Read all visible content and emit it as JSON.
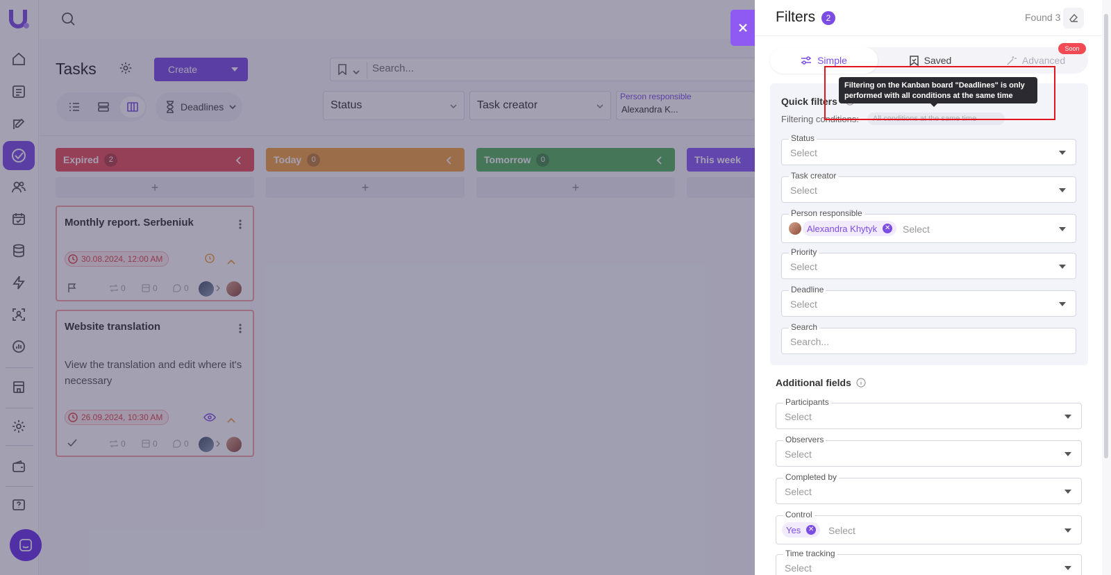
{
  "app": {
    "title": "Tasks"
  },
  "toolbar": {
    "create_label": "Create",
    "search_placeholder": "Search...",
    "view_selector": "Deadlines"
  },
  "filter_bar": {
    "status": "Status",
    "task_creator": "Task creator",
    "person_label": "Person responsible",
    "person_value": "Alexandra K..."
  },
  "columns": [
    {
      "title": "Expired",
      "count": "2",
      "color": "#e8505b"
    },
    {
      "title": "Today",
      "count": "0",
      "color": "#f2a341"
    },
    {
      "title": "Tomorrow",
      "count": "0",
      "color": "#56b25c"
    },
    {
      "title": "This week",
      "color": "#8b5cf6"
    }
  ],
  "add_symbol": "+",
  "cards": [
    {
      "title": "Monthly report. Serbeniuk",
      "description": "",
      "deadline": "30.08.2024, 12:00 AM",
      "repeats": "0",
      "subtasks": "0",
      "comments": "0"
    },
    {
      "title": "Website translation",
      "description": "View the translation and edit where it's necessary",
      "deadline": "26.09.2024, 10:30 AM",
      "repeats": "0",
      "subtasks": "0",
      "comments": "0"
    }
  ],
  "panel": {
    "title": "Filters",
    "badge": "2",
    "found": "Found 3",
    "tabs": [
      {
        "label": "Simple"
      },
      {
        "label": "Saved"
      },
      {
        "label": "Advanced"
      }
    ],
    "soon_badge": "Soon",
    "quick_filters": {
      "title": "Quick filters",
      "conditions_label": "Filtering conditions:",
      "conditions_value": "All conditions at the same time",
      "tooltip": "Filtering on the Kanban board \"Deadlines\" is only performed with all conditions at the same time"
    },
    "fields": {
      "status": {
        "label": "Status",
        "placeholder": "Select"
      },
      "task_creator": {
        "label": "Task creator",
        "placeholder": "Select"
      },
      "person_responsible": {
        "label": "Person responsible",
        "chip": "Alexandra Khytyk",
        "placeholder": "Select"
      },
      "priority": {
        "label": "Priority",
        "placeholder": "Select"
      },
      "deadline": {
        "label": "Deadline",
        "placeholder": "Select"
      },
      "search": {
        "label": "Search",
        "placeholder": "Search..."
      }
    },
    "additional": {
      "title": "Additional fields",
      "participants": {
        "label": "Participants",
        "placeholder": "Select"
      },
      "observers": {
        "label": "Observers",
        "placeholder": "Select"
      },
      "completed_by": {
        "label": "Completed by",
        "placeholder": "Select"
      },
      "control": {
        "label": "Control",
        "chip": "Yes",
        "placeholder": "Select"
      },
      "time_tracking": {
        "label": "Time tracking",
        "placeholder": "Select"
      }
    }
  },
  "colors": {
    "accent": "#7b4de4",
    "expired": "#e8505b",
    "danger": "#e0141e"
  }
}
